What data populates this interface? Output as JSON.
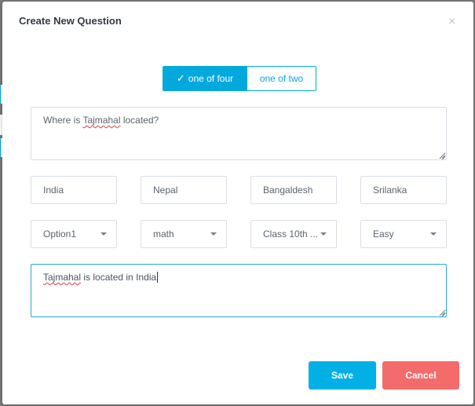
{
  "modal": {
    "title": "Create New Question",
    "close_glyph": "×"
  },
  "toggle": {
    "active_label": "one of four",
    "inactive_label": "one of two",
    "check_icon": "check-icon"
  },
  "question": {
    "prefix": "Where is ",
    "misspelled": "Tajmahal",
    "suffix": " located?"
  },
  "options": [
    "India",
    "Nepal",
    "Bangaldesh",
    "Srilanka"
  ],
  "selects": [
    "Option1",
    "math",
    "Class 10th ...",
    "Easy"
  ],
  "answer": {
    "misspelled": "Tajmahal",
    "suffix": " is located in India"
  },
  "buttons": {
    "save": "Save",
    "cancel": "Cancel"
  },
  "colors": {
    "primary": "#03a9dc",
    "danger": "#f46b6b",
    "border": "#d9dee3",
    "focus_border": "#26a9d6"
  }
}
